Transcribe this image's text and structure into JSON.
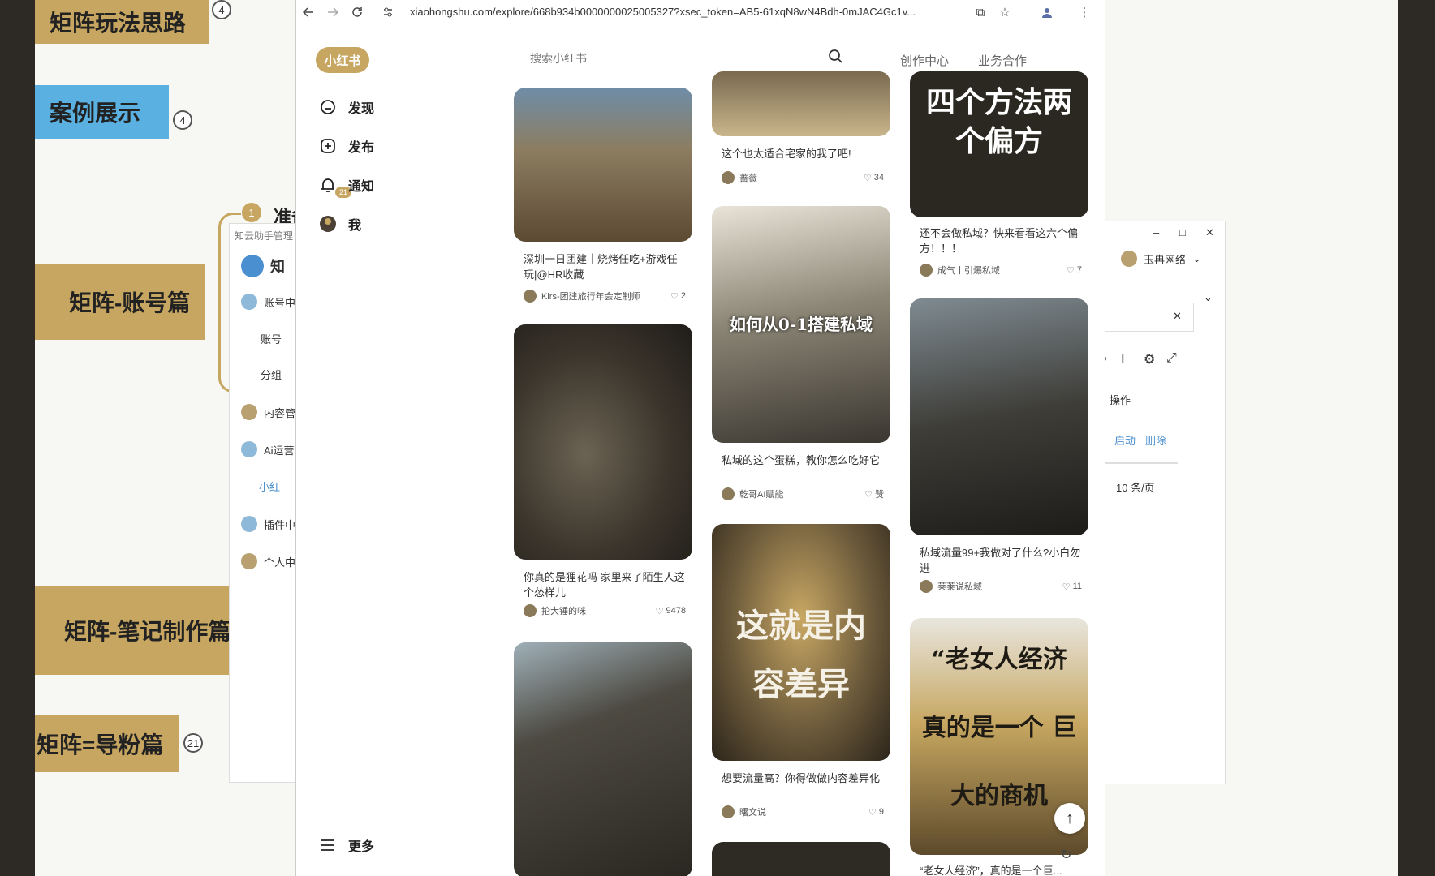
{
  "mindmap": {
    "nodes": [
      {
        "label": "矩阵玩法思路",
        "badge": "4"
      },
      {
        "label": "案例展示",
        "badge": "4"
      },
      {
        "label": "矩阵-账号篇",
        "badge": ""
      },
      {
        "label": "矩阵-笔记制作篇",
        "badge": ""
      },
      {
        "label": "矩阵=导粉篇",
        "badge": "21"
      }
    ],
    "sub_label": "准备",
    "sub_badge": "1"
  },
  "left_app": {
    "title": "知云助手管理",
    "logo_text": "知",
    "items": [
      "账号中",
      "账号",
      "分组",
      "内容管",
      "Ai运营",
      "小红",
      "插件中",
      "个人中"
    ]
  },
  "right_app": {
    "window_controls": [
      "–",
      "□",
      "✕"
    ],
    "account_name": "玉冉网络",
    "op_label": "操作",
    "start_label": "启动",
    "delete_label": "删除",
    "page_size": "10 条/页"
  },
  "browser": {
    "url": "xiaohongshu.com/explore/668b934b0000000025005327?xsec_token=AB5-61xqN8wN4Bdh-0mJAC4Gc1v..."
  },
  "xhs": {
    "logo": "小红书",
    "search_placeholder": "搜索小红书",
    "header_links": [
      "创作中心",
      "业务合作"
    ],
    "sidebar": [
      {
        "label": "发现",
        "icon": "discover-icon"
      },
      {
        "label": "发布",
        "icon": "publish-icon"
      },
      {
        "label": "通知",
        "icon": "bell-icon"
      },
      {
        "label": "我",
        "icon": "avatar-icon"
      }
    ],
    "notify_badge": "21",
    "more_label": "更多",
    "columns": [
      [
        {
          "title": "深圳一日团建｜烧烤任吃+游戏任玩|@HR收藏",
          "author": "Kirs-团建旅行年会定制师",
          "likes": "2",
          "overlay": ""
        },
        {
          "title": "你真的是狸花吗 家里来了陌生人这个怂样儿",
          "author": "抡大锤的咪",
          "likes": "9478",
          "overlay": ""
        },
        {
          "title": "",
          "author": "",
          "likes": "",
          "overlay": ""
        }
      ],
      [
        {
          "title": "这个也太适合宅家的我了吧!",
          "author": "蔷薇",
          "likes": "34",
          "overlay": ""
        },
        {
          "title": "私域的这个蛋糕，教你怎么吃好它",
          "author": "乾哥AI赋能",
          "likes": "赞",
          "overlay": "如何从0-1搭建私域"
        },
        {
          "title": "想要流量高？你得做做内容差异化",
          "author": "曙文说",
          "likes": "9",
          "overlay": "这就是内容差异"
        },
        {
          "title": "",
          "author": "",
          "likes": "",
          "overlay": ""
        }
      ],
      [
        {
          "title": "还不会做私域？快来看看这六个偏方！！！",
          "author": "成气丨引爆私域",
          "likes": "7",
          "overlay": "四个方法两个偏方"
        },
        {
          "title": "私域流量99+我做对了什么?小白勿进",
          "author": "莱莱说私域",
          "likes": "11",
          "overlay": ""
        },
        {
          "title": "“老女人经济”，真的是一个巨...",
          "author": "",
          "likes": "",
          "overlay": "“老女人经济 真的是一个 巨大的商机"
        }
      ]
    ]
  },
  "colors": {
    "accent": "#c6a660",
    "blue_node": "#5ab0e0",
    "backdrop": "#2d2a25"
  }
}
